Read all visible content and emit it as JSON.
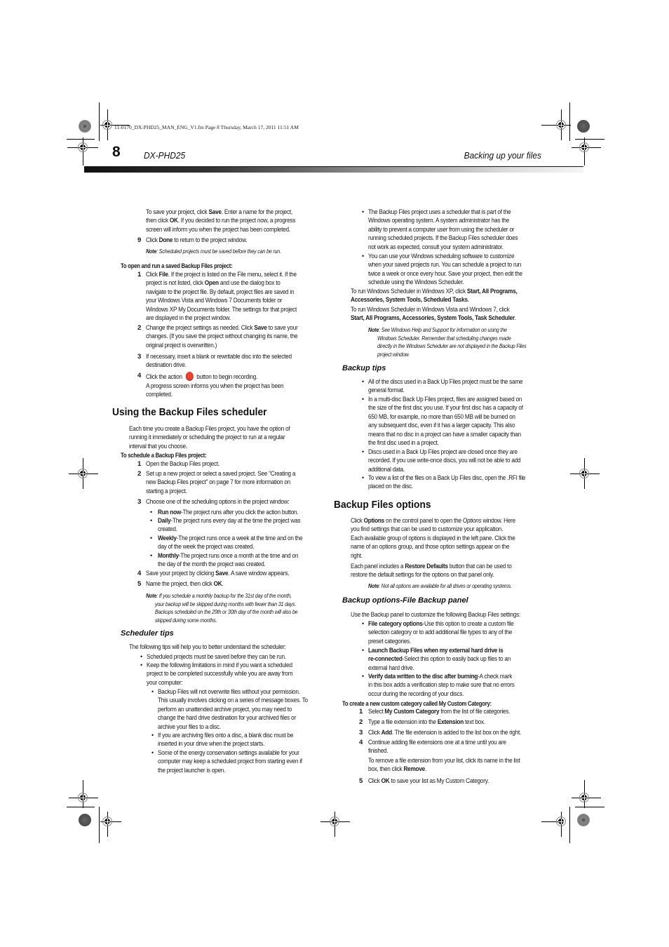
{
  "slug": "11-0170_DX-PHD25_MAN_ENG_V1.fm  Page 8  Thursday, March 17, 2011  11:51 AM",
  "header": {
    "page_number": "8",
    "model": "DX-PHD25",
    "section": "Backing up your files"
  },
  "left": {
    "intro_lines": [
      [
        "To save your project, click ",
        "Save",
        ". Enter a name for the project,"
      ],
      [
        "then click ",
        "OK",
        ". If you decided to run the project now, a progress"
      ],
      [
        "screen will inform you when the project has been completed.",
        "",
        ""
      ]
    ],
    "step9": {
      "num": "9",
      "pre": "Click ",
      "bold": "Done",
      "post": " to return to the project window."
    },
    "note1": {
      "label": "Note",
      "text": ": Scheduled projects must be saved before they can be run."
    },
    "open_heading": "To open and run a saved Backup Files project:",
    "open_steps": [
      {
        "num": "1",
        "lines": [
          [
            "Click ",
            "File",
            ". If the project is listed on the File menu, select it. If the"
          ],
          [
            "project is not listed, click ",
            "Open",
            " and use the dialog box to"
          ],
          [
            "navigate to the project file. By default, project files are saved in",
            "",
            ""
          ],
          [
            "your Windows Vista and Windows 7 Documents folder or",
            "",
            ""
          ],
          [
            "Windows XP My Documents folder. The settings for that project",
            "",
            ""
          ],
          [
            "are displayed in the project window.",
            "",
            ""
          ]
        ]
      },
      {
        "num": "2",
        "lines": [
          [
            "Change the project settings as needed. Click ",
            "Save",
            " to save your"
          ],
          [
            "changes. (If you save the project without changing its name, the",
            "",
            ""
          ],
          [
            "original project is overwritten.)",
            "",
            ""
          ]
        ]
      },
      {
        "num": "3",
        "lines": [
          [
            "If necessary, insert a blank or rewritable disc into the selected",
            "",
            ""
          ],
          [
            "destination drive.",
            "",
            ""
          ]
        ]
      },
      {
        "num": "4",
        "pre": "Click the action",
        "post": "button to begin recording.",
        "follow": [
          "A progress screen informs you when the project has been",
          "completed."
        ]
      }
    ],
    "scheduler_heading": "Using the Backup Files scheduler",
    "scheduler_intro": [
      "Each time you create a Backup Files project, you have the option of",
      "running it immediately or scheduling the project to run at a regular",
      "interval that you choose."
    ],
    "schedule_heading": "To schedule a Backup Files project:",
    "schedule_steps": [
      {
        "num": "1",
        "lines": [
          [
            "Open the Backup Files project.",
            "",
            ""
          ]
        ]
      },
      {
        "num": "2",
        "lines": [
          [
            "Set up a new project or select a saved project. See \"Creating a",
            "",
            ""
          ],
          [
            "new Backup Files project\" on page  7 for more information on",
            "",
            ""
          ],
          [
            "starting a project.",
            "",
            ""
          ]
        ]
      },
      {
        "num": "3",
        "lines": [
          [
            "Choose one of the scheduling options in the project window:",
            "",
            ""
          ]
        ]
      }
    ],
    "schedule_options": [
      {
        "bold": "Run now",
        "lines": [
          "-The project runs after you click the action button."
        ]
      },
      {
        "bold": "Daily",
        "lines": [
          "-The project runs every day at the time the project was",
          "created."
        ]
      },
      {
        "bold": "Weekly",
        "lines": [
          "-The project runs once a week at the time and on the",
          "day of the week the project was created."
        ]
      },
      {
        "bold": "Monthly",
        "lines": [
          "-The project runs once a month at the time and on",
          "the day of the month the project was created."
        ]
      }
    ],
    "schedule_steps_b": [
      {
        "num": "4",
        "pre": "Save your project by clicking ",
        "bold": "Save",
        "post": ". A save window appears."
      },
      {
        "num": "5",
        "pre": "Name the project, then click ",
        "bold": "OK",
        "post": "."
      }
    ],
    "note2": {
      "label": "Note",
      "lines": [
        ": If you schedule a monthly backup for the 31st day of the month,",
        "your backup will be skipped during months with fewer than 31 days.",
        "Backups scheduled on the 29th or 30th day of the month will also be",
        "skipped during some months."
      ]
    },
    "tips_heading": "Scheduler tips",
    "tips_intro": "The following tips will help you to better understand the scheduler:",
    "tips": [
      {
        "lines": [
          "Scheduled projects must be saved before they can be run."
        ]
      },
      {
        "lines": [
          "Keep the following limitations in mind if you want a scheduled",
          "project to be completed successfully while you are away from",
          "your computer:"
        ]
      }
    ],
    "sub_tips": [
      {
        "lines": [
          "Backup Files will not overwrite files without your permission.",
          "This usually involves clicking on a series of message boxes. To",
          "perform an unattended archive project, you may need to",
          "change the hard drive destination for your archived files or",
          "archive your files to a disc."
        ]
      },
      {
        "lines": [
          "If you are archiving files onto a disc, a blank disc must be",
          "inserted in your drive when the project starts."
        ]
      },
      {
        "lines": [
          "Some of the energy conservation settings available for your",
          "computer may keep a scheduled project from starting even if",
          "the project launcher is open."
        ]
      }
    ]
  },
  "right": {
    "sub_tips_cont": [
      {
        "lines": [
          "The Backup Files project uses a scheduler that is part of the",
          "Windows operating system. A system administrator has the",
          "ability to prevent a computer user from using the scheduler or",
          "running scheduled projects. If the Backup Files scheduler does",
          "not work as expected, consult your system administrator."
        ]
      },
      {
        "lines": [
          "You can use your Windows scheduling software to customize",
          "when your saved projects run. You can schedule a project to run",
          "twice a week or once every hour. Save your project, then edit the",
          "schedule using the Windows Scheduler."
        ]
      }
    ],
    "xp_line1": "To run Windows Scheduler in Windows XP, click ",
    "xp_bold1": "Start, All Programs,",
    "xp_bold2": "Accessories, System Tools, Scheduled Tasks",
    "vista_line1": "To run Windows Scheduler in Windows Vista and Windows 7, click",
    "vista_bold": "Start, All Programs, Accessories, System Tools, Task Scheduler",
    "note3": {
      "label": "Note",
      "lines": [
        ": See Windows Help and Support for information on using the",
        "Windows Scheduler. Remember that scheduling changes made",
        "directly in the Windows Scheduler are not displayed in the Backup Files",
        "project window."
      ]
    },
    "backup_tips_heading": "Backup tips",
    "backup_tips": [
      {
        "lines": [
          "All of the discs used in a Back Up Files project must be the same",
          "general format."
        ]
      },
      {
        "lines": [
          "In a multi-disc Back Up Files project, files are assigned based on",
          "the size of the first disc you use. If your first disc has a capacity of",
          "650 MB, for example, no more than 650 MB will be burned on",
          "any subsequent disc, even if it has a larger capacity. This also",
          "means that no disc in a project can have a smaller capacity than",
          "the first disc used in a project."
        ]
      },
      {
        "lines": [
          "Discs used in a Back Up Files project are closed once they are",
          "recorded. If you use write-once discs, you will not be able to add",
          "additional data."
        ]
      },
      {
        "lines": [
          "To view a list of the files on a Back Up Files disc, open the .RFI file",
          "placed on the disc."
        ]
      }
    ],
    "options_heading": "Backup Files options",
    "options_para1": [
      [
        "Click ",
        "Options",
        " on the control panel to open the ",
        "Options",
        " window. Here"
      ],
      [
        "you find settings that can be used to customize your application.",
        "",
        "",
        "",
        ""
      ],
      [
        "Each available group of options is displayed in the left pane. Click the",
        "",
        "",
        "",
        ""
      ],
      [
        "name of an options group, and those option settings appear on the",
        "",
        "",
        "",
        ""
      ],
      [
        "right.",
        "",
        "",
        "",
        ""
      ]
    ],
    "options_para2": [
      [
        "Each panel includes a ",
        "Restore Defaults",
        " button that can be used to"
      ],
      [
        "restore the default settings for the options on that panel only.",
        "",
        ""
      ]
    ],
    "note4": {
      "label": "Note",
      "text": ": Not all options are available for all drives or operating systems."
    },
    "panel_heading": "Backup options-File Backup panel",
    "panel_intro": "Use the Backup panel to customize the following Backup Files settings:",
    "panel_options": [
      {
        "lines": [
          [
            "File category options",
            "-Use this option to create a custom file"
          ],
          [
            "",
            "selection category or to add additional file types to any of the"
          ],
          [
            "",
            "preset categories."
          ]
        ]
      },
      {
        "lines": [
          [
            "Launch Backup Files when my external hard drive is",
            ""
          ],
          [
            "re-connected",
            "-Select this option to easily back up files to an"
          ],
          [
            "",
            "external hard drive."
          ]
        ]
      },
      {
        "lines": [
          [
            "Verify data written to the disc after burning",
            "-A check mark"
          ],
          [
            "",
            "in this box adds a verification step to make sure that no errors"
          ],
          [
            "",
            "occur during the recording of your discs."
          ]
        ]
      }
    ],
    "custom_heading": "To create a new custom category called My Custom Category:",
    "custom_steps": [
      {
        "num": "1",
        "lines": [
          [
            "Select ",
            "My Custom Category",
            " from the list of file categories."
          ]
        ]
      },
      {
        "num": "2",
        "lines": [
          [
            "Type a file extension into the ",
            "Extension",
            " text box."
          ]
        ]
      },
      {
        "num": "3",
        "lines": [
          [
            "Click ",
            "Add",
            ". The file extension is added to the list box on the right."
          ]
        ]
      },
      {
        "num": "4",
        "lines": [
          [
            "Continue adding file extensions one at a time until you are",
            "",
            ""
          ],
          [
            "finished.",
            "",
            ""
          ]
        ],
        "follow": [
          [
            "To remove a file extension from your list, click its name in the list",
            "",
            ""
          ],
          [
            "box, then click ",
            "Remove",
            "."
          ]
        ]
      },
      {
        "num": "5",
        "lines": [
          [
            "Click ",
            "OK",
            " to save your list as My Custom Category."
          ]
        ]
      }
    ]
  },
  "colors": {
    "action_button": "#e8432e"
  }
}
